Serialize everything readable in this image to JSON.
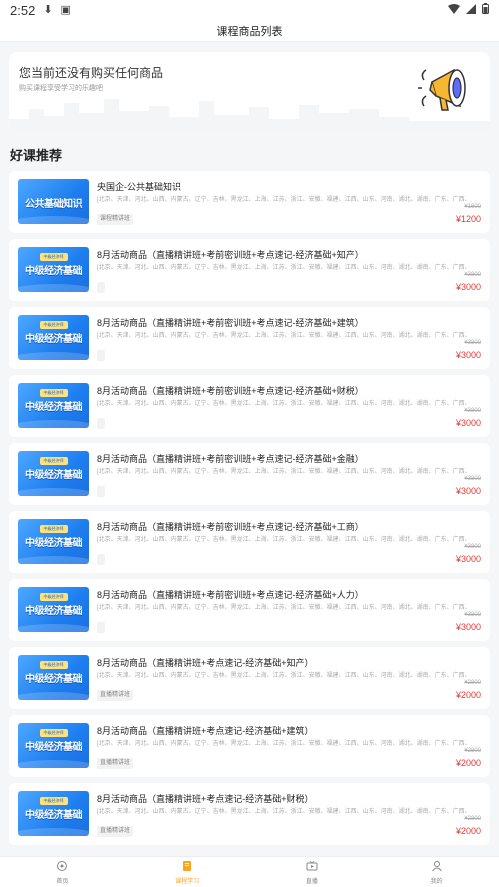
{
  "status_bar": {
    "time": "2:52"
  },
  "header": {
    "title": "课程商品列表"
  },
  "notice": {
    "title": "您当前还没有购买任何商品",
    "subtitle": "购买课程享受学习的乐趣吧"
  },
  "section": {
    "title": "好课推荐"
  },
  "courses": [
    {
      "title": "央国企-公共基础知识",
      "regions": "[北京、天津、河北、山西、内蒙古、辽宁、吉林、黑龙江、上海、江苏、浙江、安徽、福建、江西、山东、河南、湖北、湖南、广东、广西、",
      "tag": "课程精讲班",
      "orig_price": "¥1600",
      "price": "¥1200",
      "thumb_badge": "",
      "thumb_text": "公共基础知识"
    },
    {
      "title": "8月活动商品（直播精讲班+考前密训班+考点速记-经济基础+知产）",
      "regions": "[北京、天津、河北、山西、内蒙古、辽宁、吉林、黑龙江、上海、江苏、浙江、安徽、福建、江西、山东、河南、湖北、湖南、广东、广西、",
      "tag": "",
      "orig_price": "¥3800",
      "price": "¥3000",
      "thumb_badge": "中级经济师",
      "thumb_text": "中级经济基础"
    },
    {
      "title": "8月活动商品（直播精讲班+考前密训班+考点速记-经济基础+建筑）",
      "regions": "[北京、天津、河北、山西、内蒙古、辽宁、吉林、黑龙江、上海、江苏、浙江、安徽、福建、江西、山东、河南、湖北、湖南、广东、广西、",
      "tag": "",
      "orig_price": "¥3800",
      "price": "¥3000",
      "thumb_badge": "中级经济师",
      "thumb_text": "中级经济基础"
    },
    {
      "title": "8月活动商品（直播精讲班+考前密训班+考点速记-经济基础+财税）",
      "regions": "[北京、天津、河北、山西、内蒙古、辽宁、吉林、黑龙江、上海、江苏、浙江、安徽、福建、江西、山东、河南、湖北、湖南、广东、广西、",
      "tag": "",
      "orig_price": "¥3800",
      "price": "¥3000",
      "thumb_badge": "中级经济师",
      "thumb_text": "中级经济基础"
    },
    {
      "title": "8月活动商品（直播精讲班+考前密训班+考点速记-经济基础+金融）",
      "regions": "[北京、天津、河北、山西、内蒙古、辽宁、吉林、黑龙江、上海、江苏、浙江、安徽、福建、江西、山东、河南、湖北、湖南、广东、广西、",
      "tag": "",
      "orig_price": "¥3800",
      "price": "¥3000",
      "thumb_badge": "中级经济师",
      "thumb_text": "中级经济基础"
    },
    {
      "title": "8月活动商品（直播精讲班+考前密训班+考点速记-经济基础+工商）",
      "regions": "[北京、天津、河北、山西、内蒙古、辽宁、吉林、黑龙江、上海、江苏、浙江、安徽、福建、江西、山东、河南、湖北、湖南、广东、广西、",
      "tag": "",
      "orig_price": "¥3800",
      "price": "¥3000",
      "thumb_badge": "中级经济师",
      "thumb_text": "中级经济基础"
    },
    {
      "title": "8月活动商品（直播精讲班+考前密训班+考点速记-经济基础+人力）",
      "regions": "[北京、天津、河北、山西、内蒙古、辽宁、吉林、黑龙江、上海、江苏、浙江、安徽、福建、江西、山东、河南、湖北、湖南、广东、广西、",
      "tag": "",
      "orig_price": "¥3800",
      "price": "¥3000",
      "thumb_badge": "中级经济师",
      "thumb_text": "中级经济基础"
    },
    {
      "title": "8月活动商品（直播精讲班+考点速记-经济基础+知产）",
      "regions": "[北京、天津、河北、山西、内蒙古、辽宁、吉林、黑龙江、上海、江苏、浙江、安徽、福建、江西、山东、河南、湖北、湖南、广东、广西、",
      "tag": "直播精讲班",
      "orig_price": "¥2800",
      "price": "¥2000",
      "thumb_badge": "中级经济师",
      "thumb_text": "中级经济基础"
    },
    {
      "title": "8月活动商品（直播精讲班+考点速记-经济基础+建筑）",
      "regions": "[北京、天津、河北、山西、内蒙古、辽宁、吉林、黑龙江、上海、江苏、浙江、安徽、福建、江西、山东、河南、湖北、湖南、广东、广西、",
      "tag": "直播精讲班",
      "orig_price": "¥2800",
      "price": "¥2000",
      "thumb_badge": "中级经济师",
      "thumb_text": "中级经济基础"
    },
    {
      "title": "8月活动商品（直播精讲班+考点速记-经济基础+财税）",
      "regions": "[北京、天津、河北、山西、内蒙古、辽宁、吉林、黑龙江、上海、江苏、浙江、安徽、福建、江西、山东、河南、湖北、湖南、广东、广西、",
      "tag": "直播精讲班",
      "orig_price": "¥2800",
      "price": "¥2000",
      "thumb_badge": "中级经济师",
      "thumb_text": "中级经济基础"
    }
  ],
  "tabbar": {
    "items": [
      {
        "label": "首页",
        "icon": "home-icon",
        "active": false
      },
      {
        "label": "课程学习",
        "icon": "book-icon",
        "active": true
      },
      {
        "label": "直播",
        "icon": "live-icon",
        "active": false
      },
      {
        "label": "我的",
        "icon": "user-icon",
        "active": false
      }
    ]
  },
  "colors": {
    "accent": "#f5a623",
    "price": "#e53935",
    "thumb": "#1e7ff0"
  }
}
